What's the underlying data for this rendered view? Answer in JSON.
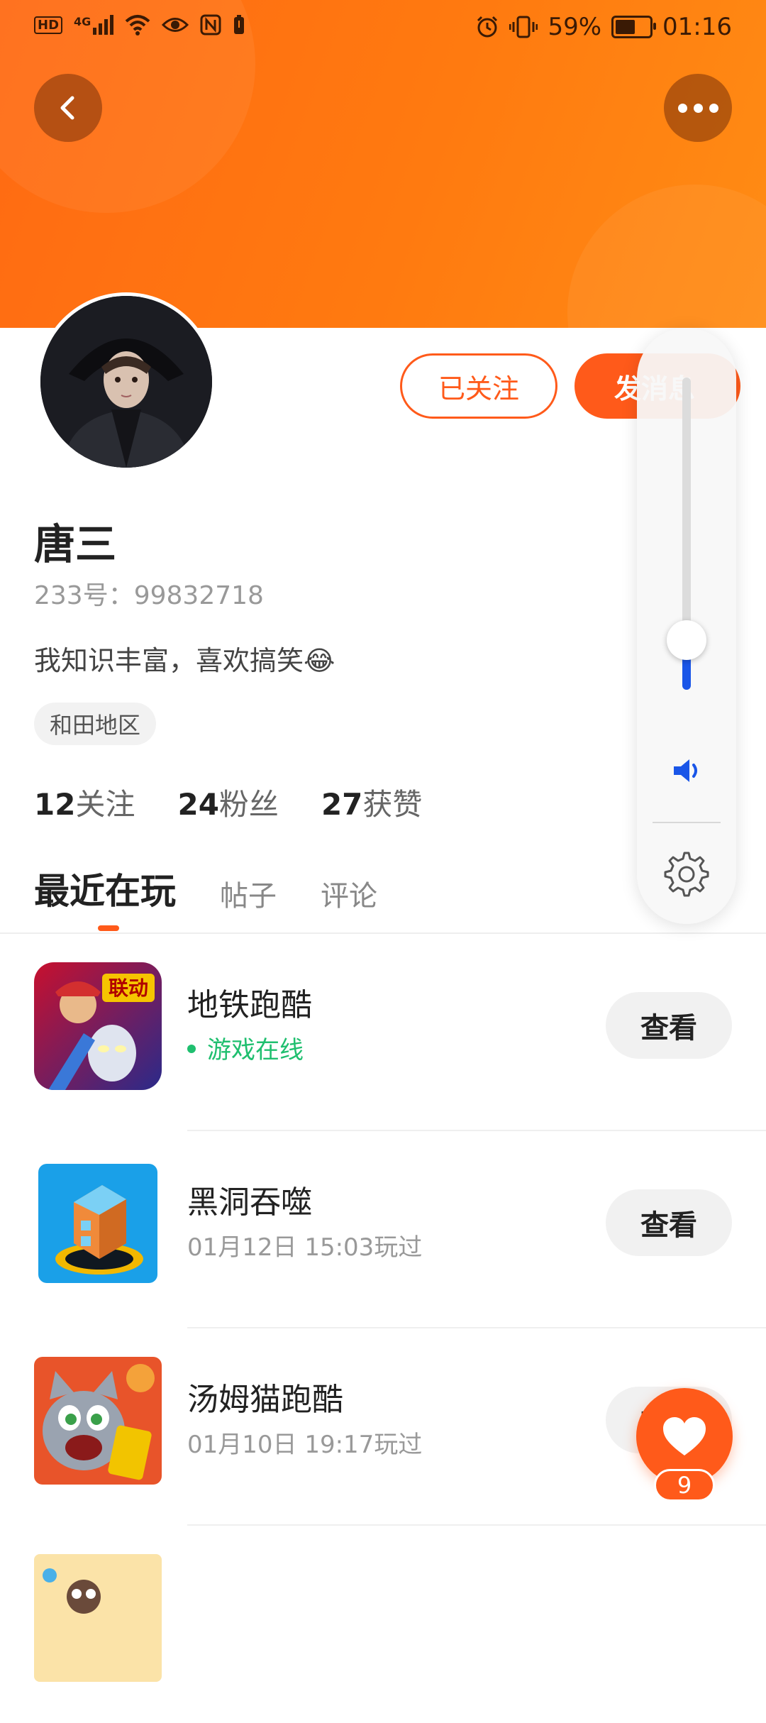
{
  "status_bar": {
    "left_icons": [
      "hd-icon",
      "4g-signal-icon",
      "wifi-icon",
      "eye-icon",
      "nfc-icon",
      "battery-saver-icon"
    ],
    "network": "4G",
    "alarm_icon": "alarm-icon",
    "vibrate_icon": "vibrate-icon",
    "battery": "59%",
    "battery_level": 0.59,
    "time": "01:16"
  },
  "header": {
    "accent_color": "#ff6a13",
    "back_icon": "chevron-left-icon",
    "more_icon": "more-dots-icon"
  },
  "profile": {
    "followed_label": "已关注",
    "message_label": "发消息",
    "name": "唐三",
    "id_line": "233号：99832718",
    "bio": "我知识丰富，喜欢搞笑😂",
    "region": "和田地区",
    "stats": [
      {
        "num": "12",
        "label": "关注"
      },
      {
        "num": "24",
        "label": "粉丝"
      },
      {
        "num": "27",
        "label": "获赞"
      }
    ]
  },
  "tabs": [
    {
      "label": "最近在玩",
      "active": true
    },
    {
      "label": "帖子",
      "active": false
    },
    {
      "label": "评论",
      "active": false
    }
  ],
  "games": [
    {
      "name": "地铁跑酷",
      "sub": "游戏在线",
      "online": true,
      "button": "查看",
      "icon_text": "联动"
    },
    {
      "name": "黑洞吞噬",
      "sub": "01月12日 15:03玩过",
      "online": false,
      "button": "查看"
    },
    {
      "name": "汤姆猫跑酷",
      "sub": "01月10日 19:17玩过",
      "online": false,
      "button": "查看"
    }
  ],
  "volume": {
    "level": 0.16,
    "accent_color": "#1a56e8",
    "speaker_icon": "speaker-icon",
    "settings_icon": "gear-icon"
  },
  "like": {
    "icon": "heart-icon",
    "count": "9"
  }
}
